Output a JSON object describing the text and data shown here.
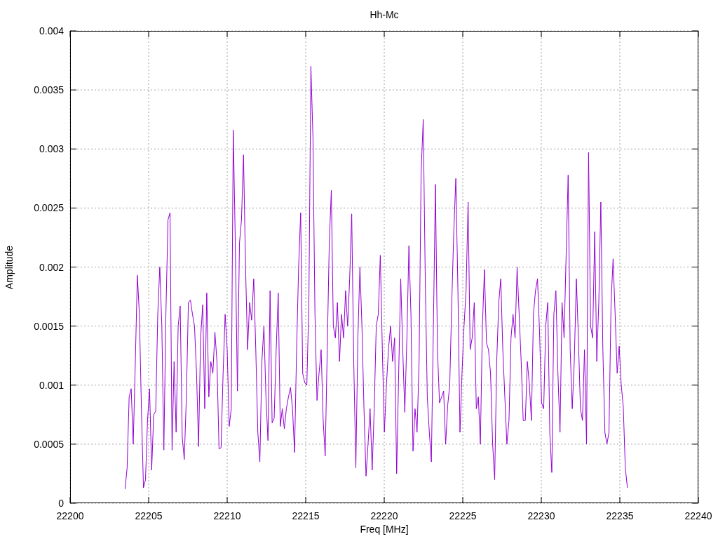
{
  "chart_data": {
    "type": "line",
    "grid": true,
    "title": "Hh-Mc",
    "xlabel": "Freq [MHz]",
    "ylabel": "Amplitude",
    "xlim": [
      22200,
      22240
    ],
    "ylim": [
      0,
      0.004
    ],
    "xticks": [
      22200,
      22205,
      22210,
      22215,
      22220,
      22225,
      22230,
      22235,
      22240
    ],
    "yticks": [
      0,
      0.0005,
      0.001,
      0.0015,
      0.002,
      0.0025,
      0.003,
      0.0035,
      0.004
    ],
    "x": [
      22203.5,
      22203.63,
      22203.76,
      22203.89,
      22204.02,
      22204.15,
      22204.28,
      22204.41,
      22204.54,
      22204.67,
      22204.8,
      22204.93,
      22205.06,
      22205.19,
      22205.32,
      22205.45,
      22205.58,
      22205.71,
      22205.84,
      22205.97,
      22206.1,
      22206.23,
      22206.36,
      22206.49,
      22206.62,
      22206.75,
      22206.88,
      22207.01,
      22207.14,
      22207.27,
      22207.4,
      22207.53,
      22207.66,
      22207.79,
      22207.92,
      22208.05,
      22208.18,
      22208.31,
      22208.44,
      22208.57,
      22208.7,
      22208.83,
      22208.96,
      22209.09,
      22209.22,
      22209.35,
      22209.48,
      22209.61,
      22209.74,
      22209.87,
      22210,
      22210.13,
      22210.26,
      22210.39,
      22210.52,
      22210.65,
      22210.78,
      22210.91,
      22211.04,
      22211.17,
      22211.3,
      22211.43,
      22211.56,
      22211.69,
      22211.82,
      22211.95,
      22212.08,
      22212.21,
      22212.34,
      22212.47,
      22212.6,
      22212.73,
      22212.86,
      22212.99,
      22213.12,
      22213.25,
      22213.38,
      22213.51,
      22213.64,
      22213.77,
      22213.9,
      22214.03,
      22214.16,
      22214.29,
      22214.42,
      22214.55,
      22214.68,
      22214.81,
      22214.94,
      22215.07,
      22215.2,
      22215.33,
      22215.46,
      22215.59,
      22215.72,
      22215.85,
      22215.98,
      22216.11,
      22216.24,
      22216.37,
      22216.5,
      22216.63,
      22216.76,
      22216.89,
      22217.02,
      22217.15,
      22217.28,
      22217.41,
      22217.54,
      22217.67,
      22217.8,
      22217.93,
      22218.06,
      22218.19,
      22218.32,
      22218.45,
      22218.58,
      22218.71,
      22218.84,
      22218.97,
      22219.1,
      22219.23,
      22219.36,
      22219.49,
      22219.62,
      22219.75,
      22219.88,
      22220.01,
      22220.14,
      22220.27,
      22220.4,
      22220.53,
      22220.66,
      22220.79,
      22220.92,
      22221.05,
      22221.18,
      22221.31,
      22221.44,
      22221.57,
      22221.7,
      22221.83,
      22221.96,
      22222.09,
      22222.22,
      22222.35,
      22222.48,
      22222.61,
      22222.74,
      22222.87,
      22223,
      22223.13,
      22223.26,
      22223.39,
      22223.52,
      22223.65,
      22223.78,
      22223.91,
      22224.04,
      22224.17,
      22224.3,
      22224.43,
      22224.56,
      22224.69,
      22224.82,
      22224.95,
      22225.08,
      22225.21,
      22225.34,
      22225.47,
      22225.6,
      22225.73,
      22225.86,
      22225.99,
      22226.12,
      22226.25,
      22226.38,
      22226.51,
      22226.64,
      22226.77,
      22226.9,
      22227.03,
      22227.16,
      22227.29,
      22227.42,
      22227.55,
      22227.68,
      22227.81,
      22227.94,
      22228.07,
      22228.2,
      22228.33,
      22228.46,
      22228.59,
      22228.72,
      22228.85,
      22228.98,
      22229.11,
      22229.24,
      22229.37,
      22229.5,
      22229.63,
      22229.76,
      22229.89,
      22230.02,
      22230.15,
      22230.28,
      22230.41,
      22230.54,
      22230.67,
      22230.8,
      22230.93,
      22231.06,
      22231.19,
      22231.32,
      22231.45,
      22231.58,
      22231.71,
      22231.84,
      22231.97,
      22232.1,
      22232.23,
      22232.36,
      22232.49,
      22232.62,
      22232.75,
      22232.88,
      22233.01,
      22233.14,
      22233.27,
      22233.4,
      22233.53,
      22233.66,
      22233.79,
      22233.92,
      22234.05,
      22234.18,
      22234.31,
      22234.44,
      22234.57,
      22234.7,
      22234.83,
      22234.96,
      22235.09,
      22235.22,
      22235.35,
      22235.48
    ],
    "series": [
      {
        "color": "#9400d3",
        "values": [
          0.00012,
          0.0003,
          0.0009,
          0.00097,
          0.0005,
          0.0012,
          0.00193,
          0.0016,
          0.0008,
          0.00013,
          0.0002,
          0.0007,
          0.00097,
          0.00028,
          0.00075,
          0.00078,
          0.0016,
          0.002,
          0.0015,
          0.00045,
          0.0016,
          0.0024,
          0.00246,
          0.00045,
          0.0012,
          0.0006,
          0.0015,
          0.00167,
          0.00056,
          0.00037,
          0.0009,
          0.0017,
          0.00172,
          0.0016,
          0.0015,
          0.0011,
          0.00048,
          0.0014,
          0.00168,
          0.0008,
          0.00178,
          0.0009,
          0.0012,
          0.0011,
          0.00145,
          0.0012,
          0.00046,
          0.00047,
          0.0011,
          0.0016,
          0.0013,
          0.00065,
          0.0008,
          0.00316,
          0.0022,
          0.00095,
          0.0022,
          0.0024,
          0.00295,
          0.002,
          0.0013,
          0.0017,
          0.00155,
          0.0019,
          0.0013,
          0.0006,
          0.00035,
          0.0012,
          0.0015,
          0.0009,
          0.00053,
          0.0018,
          0.00068,
          0.00072,
          0.0013,
          0.00178,
          0.00065,
          0.0008,
          0.00063,
          0.0008,
          0.0009,
          0.00098,
          0.0008,
          0.00043,
          0.0013,
          0.002,
          0.00246,
          0.0011,
          0.00102,
          0.001,
          0.0017,
          0.0037,
          0.0031,
          0.0016,
          0.00087,
          0.0011,
          0.0013,
          0.0007,
          0.0004,
          0.0013,
          0.0022,
          0.00265,
          0.0015,
          0.0014,
          0.0017,
          0.0012,
          0.0016,
          0.0014,
          0.0018,
          0.0015,
          0.0019,
          0.00245,
          0.0012,
          0.0003,
          0.0014,
          0.002,
          0.0015,
          0.0008,
          0.00023,
          0.0005,
          0.0008,
          0.00028,
          0.0008,
          0.0015,
          0.0016,
          0.0021,
          0.0013,
          0.0006,
          0.001,
          0.0013,
          0.0015,
          0.0012,
          0.0014,
          0.00025,
          0.0011,
          0.0019,
          0.0013,
          0.00077,
          0.0014,
          0.00218,
          0.0016,
          0.00044,
          0.0008,
          0.0006,
          0.0012,
          0.0028,
          0.00325,
          0.0019,
          0.0009,
          0.0006,
          0.00035,
          0.0015,
          0.0027,
          0.0013,
          0.00085,
          0.0009,
          0.00095,
          0.0005,
          0.00083,
          0.001,
          0.0017,
          0.0023,
          0.00275,
          0.0018,
          0.0006,
          0.0011,
          0.0015,
          0.0018,
          0.00255,
          0.0013,
          0.0014,
          0.0017,
          0.0008,
          0.0009,
          0.0005,
          0.0015,
          0.00198,
          0.00136,
          0.0013,
          0.0011,
          0.0005,
          0.0002,
          0.0012,
          0.0017,
          0.0019,
          0.0013,
          0.0009,
          0.0005,
          0.0007,
          0.0014,
          0.0016,
          0.0014,
          0.002,
          0.0016,
          0.0012,
          0.0007,
          0.0007,
          0.0012,
          0.001,
          0.0007,
          0.0016,
          0.0018,
          0.0019,
          0.00145,
          0.00085,
          0.0008,
          0.0015,
          0.0017,
          0.0006,
          0.00026,
          0.0016,
          0.0018,
          0.0011,
          0.0006,
          0.0017,
          0.0014,
          0.0021,
          0.00278,
          0.0013,
          0.0008,
          0.0012,
          0.0019,
          0.0014,
          0.0008,
          0.0007,
          0.0013,
          0.0005,
          0.00297,
          0.0015,
          0.0014,
          0.0023,
          0.0012,
          0.0017,
          0.00255,
          0.0013,
          0.0006,
          0.0005,
          0.0006,
          0.0017,
          0.00207,
          0.0016,
          0.0011,
          0.00133,
          0.001,
          0.00082,
          0.0003,
          0.00013
        ]
      }
    ]
  }
}
